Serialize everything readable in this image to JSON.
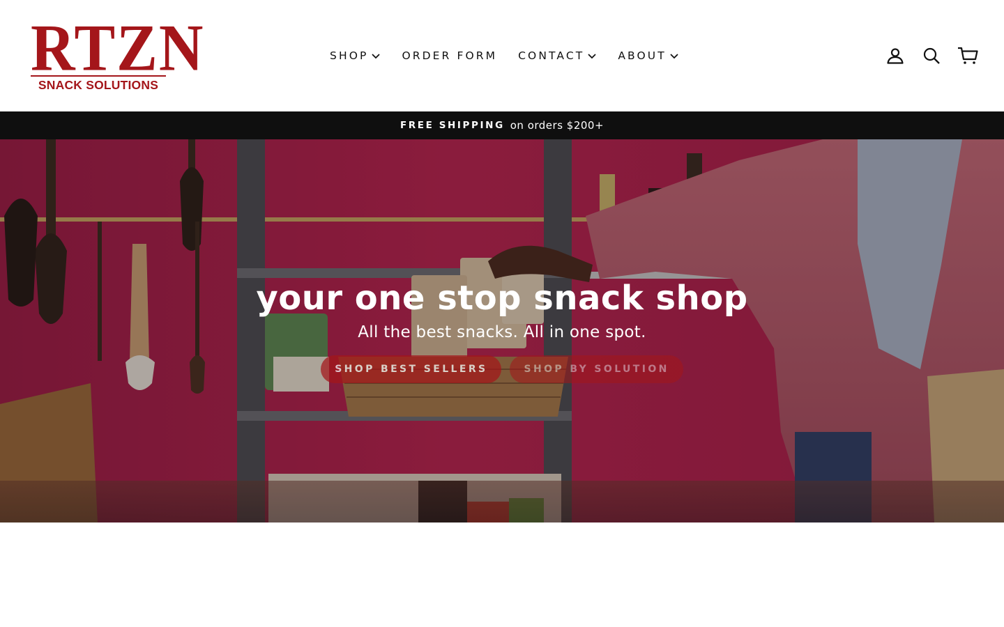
{
  "brand": {
    "logo_mark": "RTZN",
    "logo_sub": "SNACK SOLUTIONS",
    "color": "#a4161a"
  },
  "nav": {
    "items": [
      {
        "label": "SHOP",
        "has_dropdown": true
      },
      {
        "label": "ORDER FORM",
        "has_dropdown": false
      },
      {
        "label": "CONTACT",
        "has_dropdown": true
      },
      {
        "label": "ABOUT",
        "has_dropdown": true
      }
    ]
  },
  "header_icons": [
    {
      "name": "account-icon"
    },
    {
      "name": "search-icon"
    },
    {
      "name": "cart-icon"
    }
  ],
  "announcement": {
    "strong": "FREE SHIPPING",
    "rest": "on orders $200+",
    "background": "#0f0f0f"
  },
  "hero": {
    "title": "your one stop snack shop",
    "subtitle": "All the best snacks. All in one spot.",
    "buttons": [
      {
        "label": "SHOP BEST SELLERS"
      },
      {
        "label": "SHOP BY SOLUTION"
      }
    ],
    "accent": "#a4161a",
    "wall_color": "#b3204f"
  }
}
